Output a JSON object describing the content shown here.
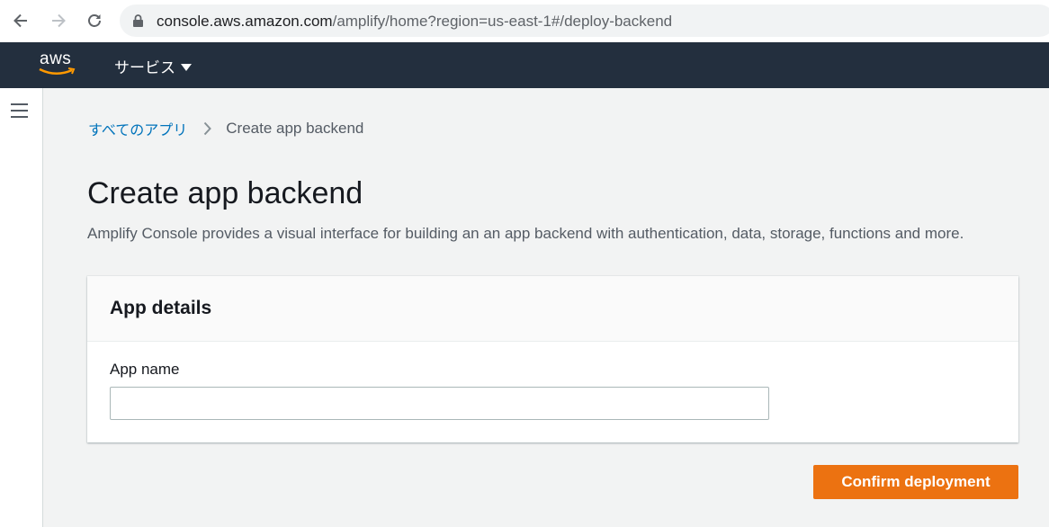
{
  "browser": {
    "url_host": "console.aws.amazon.com",
    "url_path": "/amplify/home?region=us-east-1#/deploy-backend"
  },
  "header": {
    "logo_text": "aws",
    "services_label": "サービス"
  },
  "breadcrumb": {
    "parent": "すべてのアプリ",
    "current": "Create app backend"
  },
  "page": {
    "title": "Create app backend",
    "description": "Amplify Console provides a visual interface for building an an app backend with authentication, data, storage, functions and more."
  },
  "panel": {
    "title": "App details",
    "field_label": "App name",
    "field_value": ""
  },
  "actions": {
    "confirm_label": "Confirm deployment"
  },
  "colors": {
    "header_bg": "#232f3e",
    "link": "#0073bb",
    "primary_button": "#ec7211",
    "page_bg": "#f2f3f3"
  }
}
